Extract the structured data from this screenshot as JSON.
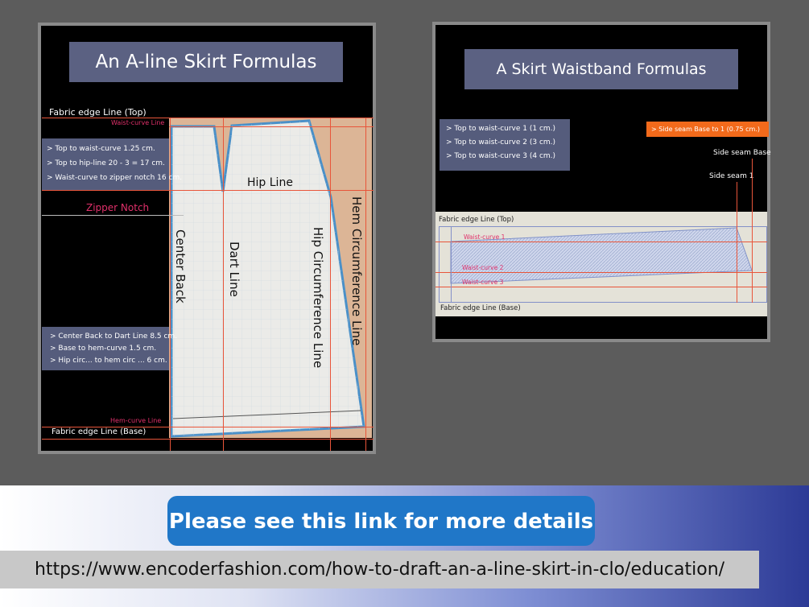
{
  "left_panel": {
    "title": "An A-line Skirt Formulas",
    "fabric_top": "Fabric edge Line (Top)",
    "waist_curve": "Waist-curve Line",
    "formulas_top": [
      "> Top to waist-curve 1.25 cm.",
      "> Top to hip-line 20 - 3 = 17 cm.",
      "> Waist-curve to zipper notch 16 cm."
    ],
    "zipper_notch": "Zipper Notch",
    "hip_line": "Hip Line",
    "center_back": "Center Back",
    "dart_line": "Dart Line",
    "hip_circ": "Hip Circumference Line",
    "hem_circ": "Hem Circumference Line",
    "formulas_bottom": [
      "> Center Back to Dart Line 8.5  cm.",
      "> Base to hem-curve 1.5 cm.",
      "> Hip circ... to hem circ ... 6 cm."
    ],
    "hem_curve": "Hem-curve Line",
    "fabric_base": "Fabric edge Line (Base)"
  },
  "right_panel": {
    "title": "A Skirt Waistband Formulas",
    "formulas": [
      "> Top to waist-curve 1 (1 cm.)",
      "> Top to waist-curve 2 (3 cm.)",
      "> Top to waist-curve 3 (4 cm.)"
    ],
    "side_seam_formula": "> Side seam Base to 1 (0.75 cm.)",
    "side_seam_base": "Side seam Base",
    "side_seam_1": "Side seam 1",
    "fabric_top": "Fabric edge Line (Top)",
    "waist_curve_1": "Waist-curve  1",
    "waist_curve_2": "Waist-curve  2",
    "waist_curve_3": "Waist-curve  3",
    "fabric_base": "Fabric edge Line (Base)"
  },
  "footer": {
    "button_label": "Please see this link for more details",
    "url": "https://www.encoderfashion.com/how-to-draft-an-a-line-skirt-in-clo/education/"
  },
  "colors": {
    "background": "#5c5c5c",
    "guide_line": "#e8553a",
    "accent_pink": "#e0306a",
    "formula_box": "#555c7c",
    "button": "#2077c8",
    "orange_tag": "#f26a1b"
  }
}
